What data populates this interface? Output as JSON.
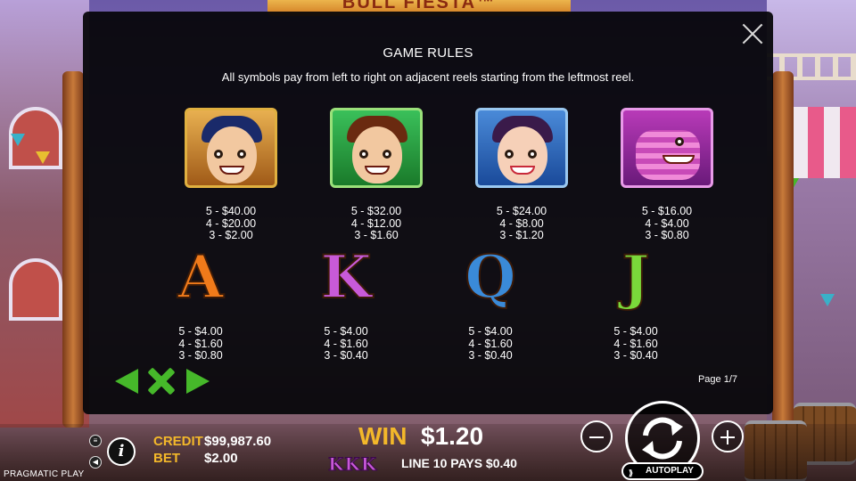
{
  "header": {
    "logo_text": "BULL FIESTA™"
  },
  "modal": {
    "title": "GAME RULES",
    "subtitle": "All symbols pay from left to right on adjacent reels starting from the leftmost reel.",
    "page": "Page 1/7",
    "symbols": [
      {
        "icon": "matador-symbol-icon",
        "pays": [
          "5 - $40.00",
          "4 - $20.00",
          "3 - $2.00"
        ]
      },
      {
        "icon": "man-red-scarf-symbol-icon",
        "pays": [
          "5 - $32.00",
          "4 - $12.00",
          "3 - $1.60"
        ]
      },
      {
        "icon": "flamenco-dancer-symbol-icon",
        "pays": [
          "5 - $24.00",
          "4 - $8.00",
          "3 - $1.20"
        ]
      },
      {
        "icon": "pinata-bull-symbol-icon",
        "pays": [
          "5 - $16.00",
          "4 - $4.00",
          "3 - $0.80"
        ]
      },
      {
        "letter": "A",
        "color": "#f07a1a",
        "pays": [
          "5 - $4.00",
          "4 - $1.60",
          "3 - $0.80"
        ]
      },
      {
        "letter": "K",
        "color": "#c85ad8",
        "pays": [
          "5 - $4.00",
          "4 - $1.60",
          "3 - $0.40"
        ]
      },
      {
        "letter": "Q",
        "color": "#3a8ad8",
        "pays": [
          "5 - $4.00",
          "4 - $1.60",
          "3 - $0.40"
        ]
      },
      {
        "letter": "J",
        "color": "#7ad83a",
        "pays": [
          "5 - $4.00",
          "4 - $1.60",
          "3 - $0.40"
        ]
      }
    ]
  },
  "bottom": {
    "credit_label": "CREDIT",
    "credit_value": "$99,987.60",
    "bet_label": "BET",
    "bet_value": "$2.00",
    "win_label": "WIN",
    "win_value": "$1.20",
    "win_symbols": "KKK",
    "line_pay": "LINE 10 PAYS $0.40",
    "autoplay_label": "AUTOPLAY",
    "brand": "PRAGMATIC PLAY"
  },
  "colors": {
    "accent": "#f3b82a",
    "nav_green": "#46b82a"
  }
}
